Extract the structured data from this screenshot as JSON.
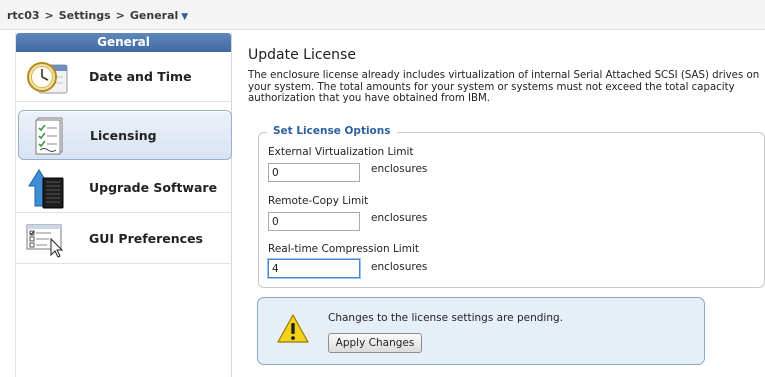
{
  "breadcrumb": {
    "items": [
      "rtc03",
      "Settings",
      "General"
    ],
    "separator": ">",
    "dropdown_icon": "triangle-down-icon"
  },
  "sidebar": {
    "header": "General",
    "items": [
      {
        "label": "Date and Time",
        "icon": "clock-calendar-icon",
        "selected": false
      },
      {
        "label": "Licensing",
        "icon": "license-document-icon",
        "selected": true
      },
      {
        "label": "Upgrade Software",
        "icon": "upgrade-server-icon",
        "selected": false
      },
      {
        "label": "GUI Preferences",
        "icon": "gui-preferences-icon",
        "selected": false
      }
    ]
  },
  "main": {
    "title": "Update License",
    "description": "The enclosure license already includes virtualization of internal Serial Attached SCSI (SAS) drives on your system. The total amounts for your system or systems must not exceed the total capacity authorization that you have obtained from IBM.",
    "license_options": {
      "legend": "Set License Options",
      "fields": [
        {
          "label": "External Virtualization Limit",
          "value": "0",
          "unit": "enclosures"
        },
        {
          "label": "Remote-Copy Limit",
          "value": "0",
          "unit": "enclosures"
        },
        {
          "label": "Real-time Compression Limit",
          "value": "4",
          "unit": "enclosures"
        }
      ]
    },
    "alert": {
      "icon": "warning-icon",
      "message": "Changes to the license settings are pending.",
      "button_label": "Apply Changes"
    }
  },
  "colors": {
    "accent": "#2b5f9e",
    "header_bar": "#4a75ad",
    "selection_bg": "#dde7f4",
    "alert_bg": "#e6eef8",
    "warning": "#f5d21a"
  }
}
